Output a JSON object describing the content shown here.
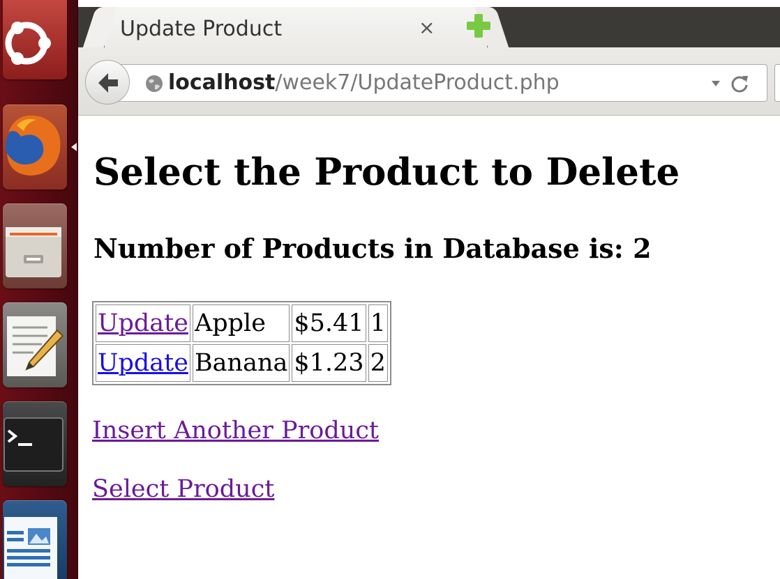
{
  "launcher": {
    "items": [
      {
        "name": "ubuntu-dash-icon"
      },
      {
        "name": "firefox-icon"
      },
      {
        "name": "files-icon"
      },
      {
        "name": "text-editor-icon"
      },
      {
        "name": "terminal-icon"
      },
      {
        "name": "writer-icon"
      }
    ]
  },
  "browser": {
    "tab_title": "Update Product",
    "close_symbol": "×",
    "url_host": "localhost",
    "url_path": "/week7/UpdateProduct.php"
  },
  "page": {
    "title": "Select the Product to Delete",
    "count_text": "Number of Products in Database is: 2",
    "products": [
      {
        "action": "Update",
        "name": "Apple",
        "price": "$5.41",
        "id": "1"
      },
      {
        "action": "Update",
        "name": "Banana",
        "price": "$1.23",
        "id": "2"
      }
    ],
    "links": {
      "insert": "Insert Another Product",
      "select": "Select Product"
    }
  },
  "colors": {
    "launcher_bg": "#570a12",
    "link_unvisited": "#1a0ee6",
    "link_visited": "#6a1b9a",
    "new_tab_plus": "#7ac943"
  }
}
